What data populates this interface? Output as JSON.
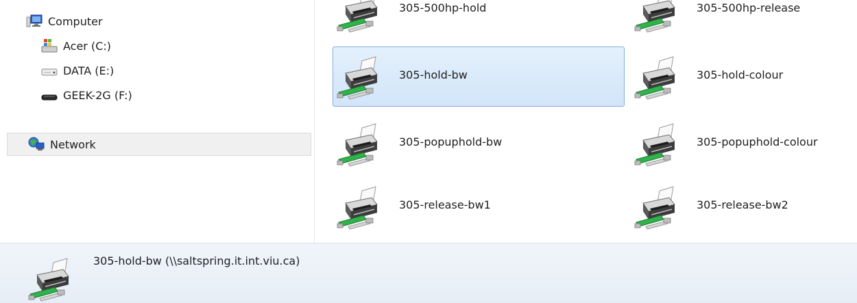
{
  "nav": {
    "computer": {
      "label": "Computer",
      "icon": "computer-icon"
    },
    "drives": [
      {
        "label": "Acer (C:)",
        "icon": "windows-drive-icon"
      },
      {
        "label": "DATA (E:)",
        "icon": "hard-drive-icon"
      },
      {
        "label": "GEEK-2G (F:)",
        "icon": "usb-drive-icon"
      }
    ],
    "network": {
      "label": "Network",
      "icon": "network-icon"
    }
  },
  "printers": [
    {
      "name": "305-500hp-hold",
      "icon": "network-printer-icon"
    },
    {
      "name": "305-500hp-release",
      "icon": "network-printer-icon"
    },
    {
      "name": "305-hold-bw",
      "icon": "network-printer-icon",
      "selected": true
    },
    {
      "name": "305-hold-colour",
      "icon": "network-printer-icon"
    },
    {
      "name": "305-popuphold-bw",
      "icon": "network-printer-icon"
    },
    {
      "name": "305-popuphold-colour",
      "icon": "network-printer-icon"
    },
    {
      "name": "305-release-bw1",
      "icon": "network-printer-icon"
    },
    {
      "name": "305-release-bw2",
      "icon": "network-printer-icon"
    }
  ],
  "details": {
    "text": "305-hold-bw (\\\\saltspring.it.int.viu.ca)",
    "icon": "network-printer-icon"
  },
  "colors": {
    "selection_border": "#84acdd",
    "selection_fill": "#d8e8fa",
    "cable_green": "#2fb34a"
  }
}
